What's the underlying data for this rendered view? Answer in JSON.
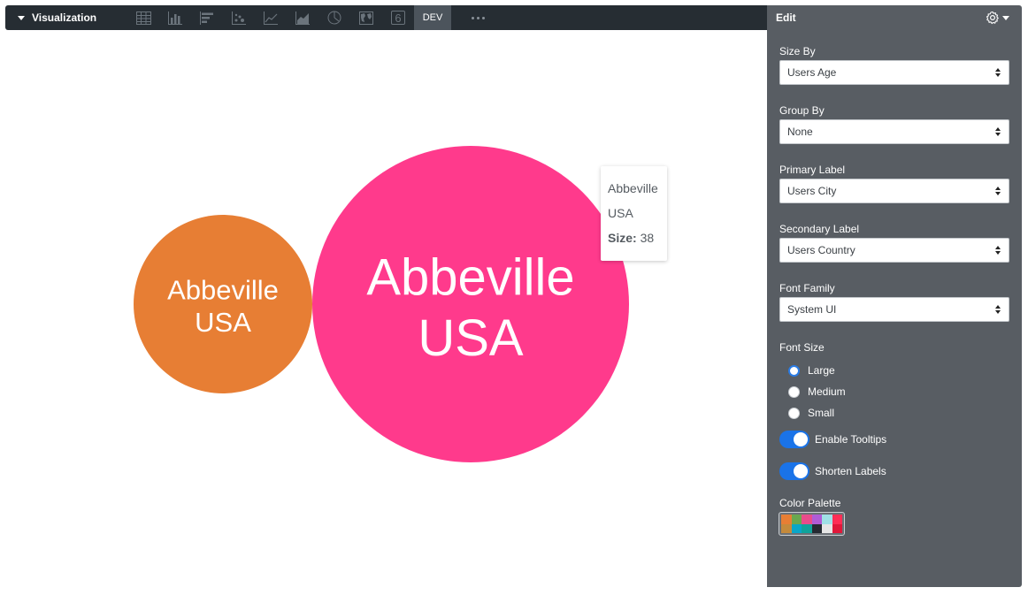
{
  "toolbar": {
    "title": "Visualization",
    "vis_types": [
      "table-icon",
      "column-chart-icon",
      "bar-chart-icon",
      "scatter-icon",
      "line-chart-icon",
      "area-chart-icon",
      "pie-chart-icon",
      "map-icon",
      "single-value-icon"
    ],
    "single_value_glyph": "6",
    "dev_tab": "DEV"
  },
  "tooltip": {
    "line1": "Abbeville",
    "line2": "USA",
    "size_label": "Size:",
    "size_value": "38"
  },
  "chart_data": {
    "type": "bubble",
    "bubbles": [
      {
        "primary": "Abbeville",
        "secondary": "USA",
        "size": null,
        "color": "#e77e34"
      },
      {
        "primary": "Abbeville",
        "secondary": "USA",
        "size": 38,
        "color": "#ff3a8c"
      }
    ]
  },
  "panel": {
    "title": "Edit",
    "size_by": {
      "label": "Size By",
      "value": "Users Age"
    },
    "group_by": {
      "label": "Group By",
      "value": "None"
    },
    "primary_label": {
      "label": "Primary Label",
      "value": "Users City"
    },
    "secondary_label": {
      "label": "Secondary Label",
      "value": "Users Country"
    },
    "font_family": {
      "label": "Font Family",
      "value": "System UI"
    },
    "font_size": {
      "label": "Font Size",
      "options": [
        "Large",
        "Medium",
        "Small"
      ],
      "selected": "Large"
    },
    "enable_tooltips": {
      "label": "Enable Tooltips",
      "on": true
    },
    "shorten_labels": {
      "label": "Shorten Labels",
      "on": true
    },
    "color_palette": {
      "label": "Color Palette",
      "colors": [
        "#e77e34",
        "#6aa84f",
        "#e84c8b",
        "#b05cd6",
        "#9fe0e6",
        "#ff2d55",
        "#c48a3c",
        "#0aa6c7",
        "#10a39b",
        "#252a32",
        "#e6e6e6",
        "#e0183a"
      ]
    }
  }
}
